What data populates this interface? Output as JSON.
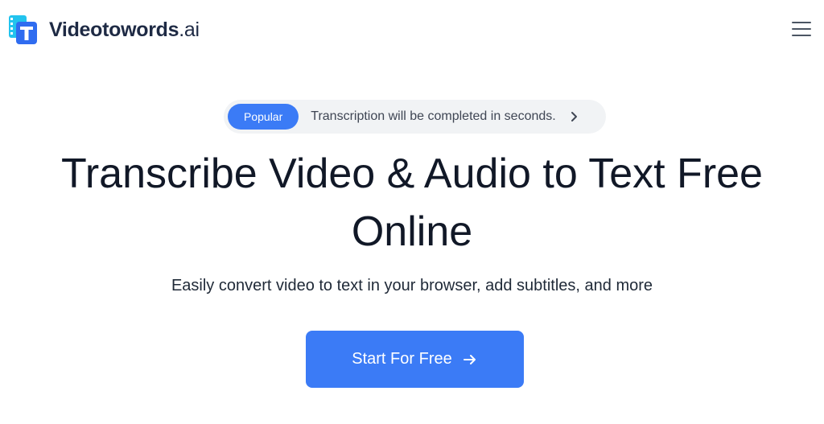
{
  "header": {
    "brand_name": "Videotowords",
    "brand_suffix": ".ai",
    "menu_icon": "hamburger-menu-icon"
  },
  "announcement": {
    "tag": "Popular",
    "text": "Transcription will be completed in seconds.",
    "icon": "chevron-right-icon"
  },
  "hero": {
    "title_line1": "Transcribe Video & Audio to Text Free",
    "title_line2": "Online",
    "subtitle": "Easily convert video to text in your browser, add subtitles, and more",
    "cta_label": "Start For Free",
    "cta_icon": "arrow-right-icon"
  },
  "colors": {
    "accent": "#3b7bf6",
    "badge_bg": "#f1f3f5",
    "brand_text": "#1e2a44"
  }
}
